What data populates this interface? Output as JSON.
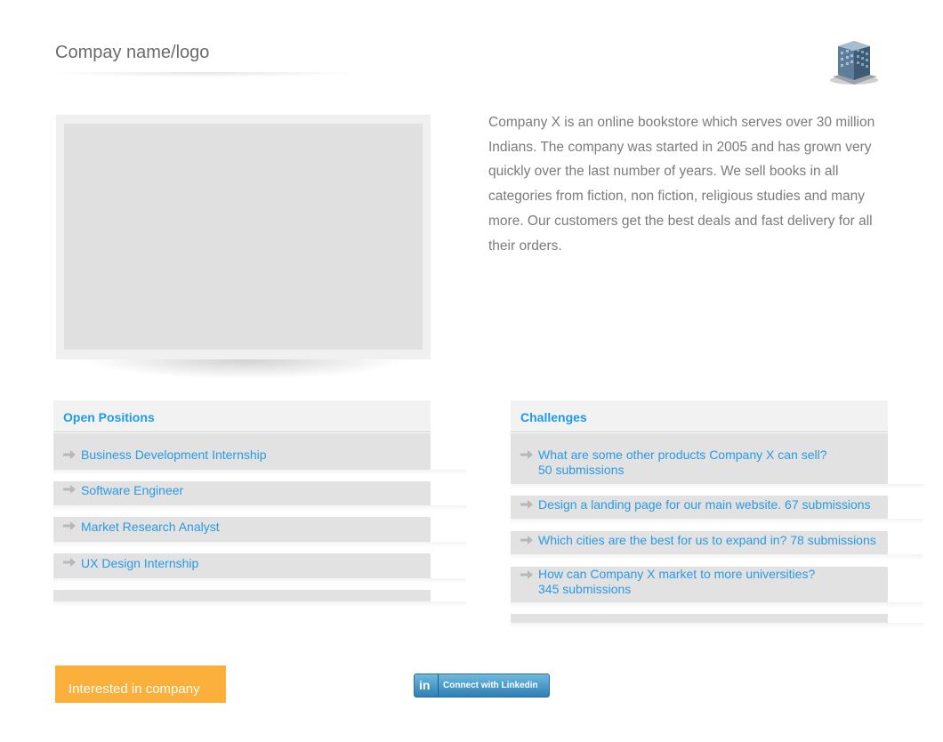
{
  "header": {
    "brand": "Compay name/logo",
    "logo_icon": "building-icon"
  },
  "about": {
    "description": "Company X is an online bookstore which serves over 30 million Indians.  The company was started in 2005 and has grown very quickly over the last number of years.  We sell books in all categories from fiction, non fiction, religious studies and many more. Our customers get the best deals and fast delivery for all their orders."
  },
  "positions": {
    "title": "Open Positions",
    "items": [
      "Business Development Internship",
      "Software Engineer",
      "Market Research Analyst",
      "UX Design Internship"
    ]
  },
  "challenges": {
    "title": "Challenges",
    "items": [
      {
        "line1": "What are some other products Company X can sell?",
        "line2": "50 submissions"
      },
      {
        "line1": "Design a landing page for our main website.  67 submissions"
      },
      {
        "line1": "Which cities are the best for us to expand in?  78 submissions"
      },
      {
        "line1": "How can Company X market to more universities?",
        "line2": "345 submissions"
      }
    ]
  },
  "actions": {
    "interested_label": "Interested in company",
    "linkedin_logo": "in",
    "linkedin_label": "Connect with Linkedin"
  },
  "colors": {
    "link": "#2a9ae4",
    "accent": "#fbb03b",
    "linkedin": "#2d7fb5"
  },
  "icons": {
    "row_arrow": "arrow-right-icon"
  }
}
